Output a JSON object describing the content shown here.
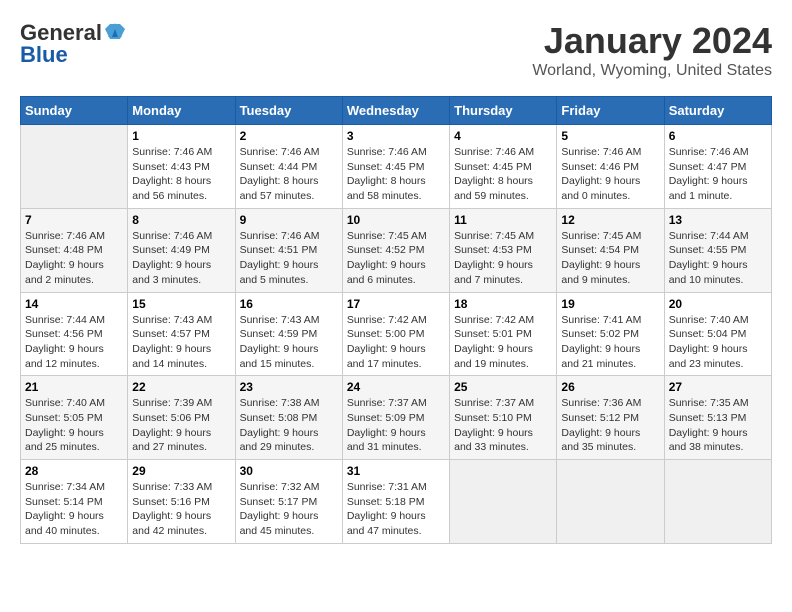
{
  "header": {
    "logo_line1": "General",
    "logo_line2": "Blue",
    "title": "January 2024",
    "subtitle": "Worland, Wyoming, United States"
  },
  "days_of_week": [
    "Sunday",
    "Monday",
    "Tuesday",
    "Wednesday",
    "Thursday",
    "Friday",
    "Saturday"
  ],
  "weeks": [
    [
      {
        "day": "",
        "info": ""
      },
      {
        "day": "1",
        "info": "Sunrise: 7:46 AM\nSunset: 4:43 PM\nDaylight: 8 hours\nand 56 minutes."
      },
      {
        "day": "2",
        "info": "Sunrise: 7:46 AM\nSunset: 4:44 PM\nDaylight: 8 hours\nand 57 minutes."
      },
      {
        "day": "3",
        "info": "Sunrise: 7:46 AM\nSunset: 4:45 PM\nDaylight: 8 hours\nand 58 minutes."
      },
      {
        "day": "4",
        "info": "Sunrise: 7:46 AM\nSunset: 4:45 PM\nDaylight: 8 hours\nand 59 minutes."
      },
      {
        "day": "5",
        "info": "Sunrise: 7:46 AM\nSunset: 4:46 PM\nDaylight: 9 hours\nand 0 minutes."
      },
      {
        "day": "6",
        "info": "Sunrise: 7:46 AM\nSunset: 4:47 PM\nDaylight: 9 hours\nand 1 minute."
      }
    ],
    [
      {
        "day": "7",
        "info": "Sunrise: 7:46 AM\nSunset: 4:48 PM\nDaylight: 9 hours\nand 2 minutes."
      },
      {
        "day": "8",
        "info": "Sunrise: 7:46 AM\nSunset: 4:49 PM\nDaylight: 9 hours\nand 3 minutes."
      },
      {
        "day": "9",
        "info": "Sunrise: 7:46 AM\nSunset: 4:51 PM\nDaylight: 9 hours\nand 5 minutes."
      },
      {
        "day": "10",
        "info": "Sunrise: 7:45 AM\nSunset: 4:52 PM\nDaylight: 9 hours\nand 6 minutes."
      },
      {
        "day": "11",
        "info": "Sunrise: 7:45 AM\nSunset: 4:53 PM\nDaylight: 9 hours\nand 7 minutes."
      },
      {
        "day": "12",
        "info": "Sunrise: 7:45 AM\nSunset: 4:54 PM\nDaylight: 9 hours\nand 9 minutes."
      },
      {
        "day": "13",
        "info": "Sunrise: 7:44 AM\nSunset: 4:55 PM\nDaylight: 9 hours\nand 10 minutes."
      }
    ],
    [
      {
        "day": "14",
        "info": "Sunrise: 7:44 AM\nSunset: 4:56 PM\nDaylight: 9 hours\nand 12 minutes."
      },
      {
        "day": "15",
        "info": "Sunrise: 7:43 AM\nSunset: 4:57 PM\nDaylight: 9 hours\nand 14 minutes."
      },
      {
        "day": "16",
        "info": "Sunrise: 7:43 AM\nSunset: 4:59 PM\nDaylight: 9 hours\nand 15 minutes."
      },
      {
        "day": "17",
        "info": "Sunrise: 7:42 AM\nSunset: 5:00 PM\nDaylight: 9 hours\nand 17 minutes."
      },
      {
        "day": "18",
        "info": "Sunrise: 7:42 AM\nSunset: 5:01 PM\nDaylight: 9 hours\nand 19 minutes."
      },
      {
        "day": "19",
        "info": "Sunrise: 7:41 AM\nSunset: 5:02 PM\nDaylight: 9 hours\nand 21 minutes."
      },
      {
        "day": "20",
        "info": "Sunrise: 7:40 AM\nSunset: 5:04 PM\nDaylight: 9 hours\nand 23 minutes."
      }
    ],
    [
      {
        "day": "21",
        "info": "Sunrise: 7:40 AM\nSunset: 5:05 PM\nDaylight: 9 hours\nand 25 minutes."
      },
      {
        "day": "22",
        "info": "Sunrise: 7:39 AM\nSunset: 5:06 PM\nDaylight: 9 hours\nand 27 minutes."
      },
      {
        "day": "23",
        "info": "Sunrise: 7:38 AM\nSunset: 5:08 PM\nDaylight: 9 hours\nand 29 minutes."
      },
      {
        "day": "24",
        "info": "Sunrise: 7:37 AM\nSunset: 5:09 PM\nDaylight: 9 hours\nand 31 minutes."
      },
      {
        "day": "25",
        "info": "Sunrise: 7:37 AM\nSunset: 5:10 PM\nDaylight: 9 hours\nand 33 minutes."
      },
      {
        "day": "26",
        "info": "Sunrise: 7:36 AM\nSunset: 5:12 PM\nDaylight: 9 hours\nand 35 minutes."
      },
      {
        "day": "27",
        "info": "Sunrise: 7:35 AM\nSunset: 5:13 PM\nDaylight: 9 hours\nand 38 minutes."
      }
    ],
    [
      {
        "day": "28",
        "info": "Sunrise: 7:34 AM\nSunset: 5:14 PM\nDaylight: 9 hours\nand 40 minutes."
      },
      {
        "day": "29",
        "info": "Sunrise: 7:33 AM\nSunset: 5:16 PM\nDaylight: 9 hours\nand 42 minutes."
      },
      {
        "day": "30",
        "info": "Sunrise: 7:32 AM\nSunset: 5:17 PM\nDaylight: 9 hours\nand 45 minutes."
      },
      {
        "day": "31",
        "info": "Sunrise: 7:31 AM\nSunset: 5:18 PM\nDaylight: 9 hours\nand 47 minutes."
      },
      {
        "day": "",
        "info": ""
      },
      {
        "day": "",
        "info": ""
      },
      {
        "day": "",
        "info": ""
      }
    ]
  ]
}
